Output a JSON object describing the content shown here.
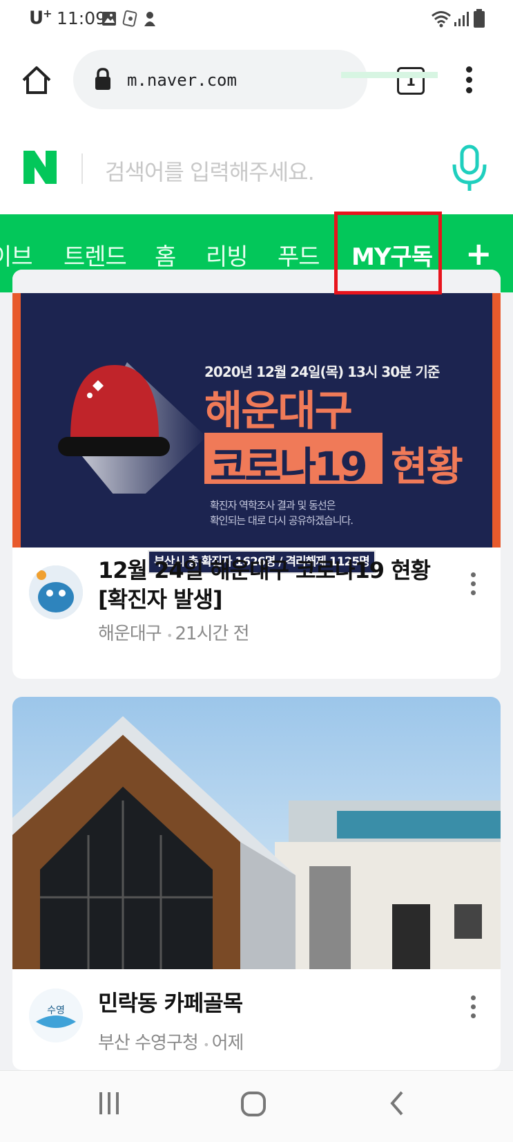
{
  "status_bar": {
    "carrier": "U",
    "carrier_sup": "+",
    "time": "11:09",
    "icons": [
      "gallery-icon",
      "notification-icon",
      "app-icon",
      "wifi-icon",
      "signal-icon",
      "battery-icon"
    ]
  },
  "browser": {
    "url": "m.naver.com",
    "tab_count": "1",
    "icons": [
      "home-icon",
      "lock-icon",
      "tabs-icon",
      "menu-icon"
    ]
  },
  "search": {
    "logo": "N",
    "placeholder": "검색어를 입력해주세요.",
    "voice_icon": "mic-icon"
  },
  "nav": {
    "items": [
      "이브",
      "트렌드",
      "홈",
      "리빙",
      "푸드",
      "MY구독"
    ],
    "active": "MY구독",
    "add_label": "+"
  },
  "feed": [
    {
      "banner": {
        "date": "2020년 12월 24일(목) 13시 30분 기준",
        "line1": "해운대구",
        "line2": "코로나19",
        "line3": "현황",
        "desc1": "확진자 역학조사 결과 및 동선은",
        "desc2": "확인되는 대로 다시 공유하겠습니다.",
        "stat": "부산시 총 확진자 1626명 / 격리해제 1125명"
      },
      "title": "12월 24일 해운대구 코로나19 현황 [확진자 발생]",
      "source": "해운대구",
      "time": "21시간 전"
    },
    {
      "title": "민락동 카페골목",
      "source": "부산 수영구청",
      "time": "어제"
    }
  ],
  "colors": {
    "naver_green": "#03c75a",
    "highlight_red": "#e8141d",
    "banner_navy": "#1c2450",
    "banner_coral": "#f07a58"
  }
}
